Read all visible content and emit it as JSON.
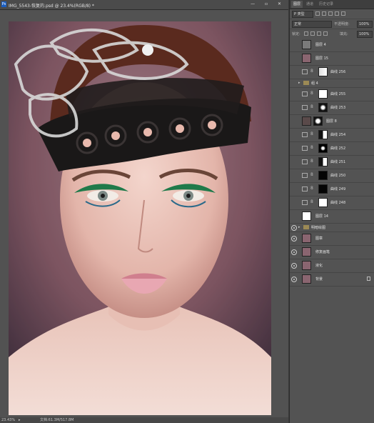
{
  "document": {
    "title": "IMG_5543-恢复的.psd @ 23.4%(RGB/8) *",
    "window_controls": "—  ▫  ✕",
    "zoom_readout": "23.43%",
    "doc_info": "文档:61.3M/517.8M",
    "nav_arrow": "▸"
  },
  "panel": {
    "tabs": [
      "图层",
      "通道",
      "历史记录"
    ],
    "filter_kind": "P 类型",
    "blend_mode": "正常",
    "opacity_label": "不透明度:",
    "opacity_value": "100%",
    "lock_label": "锁定:",
    "fill_label": "填充:",
    "fill_value": "100%"
  },
  "layers": [
    {
      "name": "图层 4",
      "kind": "pixel",
      "visible": false,
      "thumb": "#7a7a7a"
    },
    {
      "name": "图层 15",
      "kind": "pixel",
      "visible": false,
      "thumb": "#8a6570"
    },
    {
      "name": "曲线 256",
      "kind": "curves",
      "visible": false,
      "mask": "white-gradient"
    },
    {
      "name": "组 4",
      "kind": "group",
      "visible": false
    },
    {
      "name": "曲线 255",
      "kind": "curves",
      "visible": false,
      "mask": "white"
    },
    {
      "name": "曲线 253",
      "kind": "curves",
      "visible": false,
      "mask": "face"
    },
    {
      "name": "图层 8",
      "kind": "pixel-mask",
      "visible": false,
      "thumb": "#5a4a4a"
    },
    {
      "name": "曲线 254",
      "kind": "curves",
      "visible": false,
      "mask": "black-white"
    },
    {
      "name": "曲线 252",
      "kind": "curves",
      "visible": false,
      "mask": "black-spot"
    },
    {
      "name": "曲线 251",
      "kind": "curves",
      "visible": false,
      "mask": "black-white"
    },
    {
      "name": "曲线 250",
      "kind": "curves",
      "visible": false,
      "mask": "black"
    },
    {
      "name": "曲线 249",
      "kind": "curves",
      "visible": false,
      "mask": "black"
    },
    {
      "name": "曲线 248",
      "kind": "curves",
      "visible": false,
      "mask": "white"
    },
    {
      "name": "图层 14",
      "kind": "pixel",
      "visible": false,
      "thumb": "#ffffff"
    },
    {
      "name": "明暗绘图",
      "kind": "group",
      "visible": true
    },
    {
      "name": "图章",
      "kind": "pixel",
      "visible": true,
      "thumb": "#8a6570"
    },
    {
      "name": "修复画笔",
      "kind": "pixel",
      "visible": true,
      "thumb": "#8a6570"
    },
    {
      "name": "液化",
      "kind": "pixel",
      "visible": true,
      "thumb": "#8a6570"
    },
    {
      "name": "背景",
      "kind": "background",
      "visible": true,
      "thumb": "#8a6570"
    }
  ]
}
